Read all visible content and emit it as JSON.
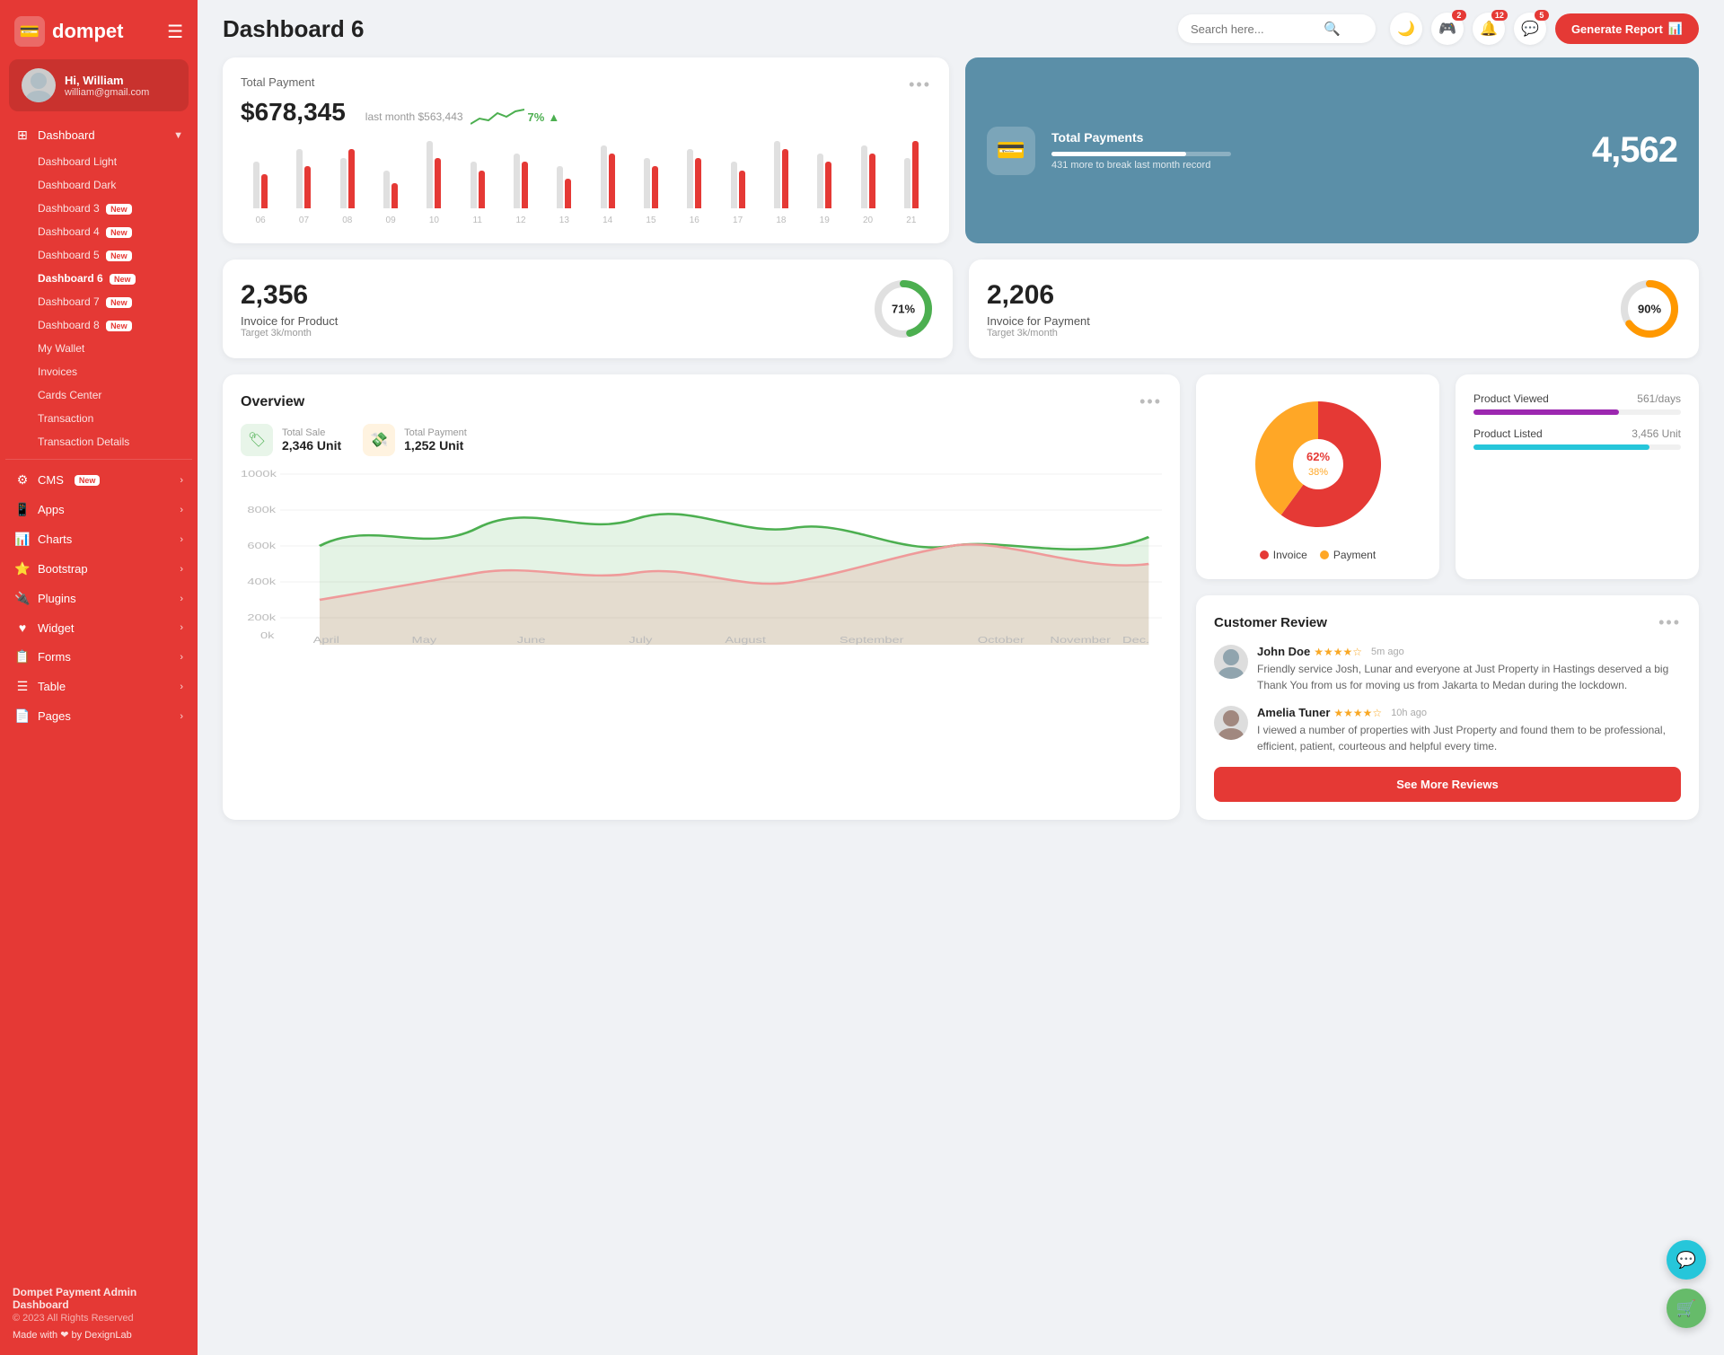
{
  "sidebar": {
    "logo_text": "dompet",
    "hamburger_label": "☰",
    "user": {
      "greeting": "Hi, William",
      "email": "william@gmail.com"
    },
    "dashboard_section": {
      "label": "Dashboard",
      "sub_items": [
        {
          "label": "Dashboard Light",
          "active": false
        },
        {
          "label": "Dashboard Dark",
          "active": false
        },
        {
          "label": "Dashboard 3",
          "active": false,
          "badge": "New"
        },
        {
          "label": "Dashboard 4",
          "active": false,
          "badge": "New"
        },
        {
          "label": "Dashboard 5",
          "active": false,
          "badge": "New"
        },
        {
          "label": "Dashboard 6",
          "active": true,
          "badge": "New"
        },
        {
          "label": "Dashboard 7",
          "active": false,
          "badge": "New"
        },
        {
          "label": "Dashboard 8",
          "active": false,
          "badge": "New"
        },
        {
          "label": "My Wallet",
          "active": false
        },
        {
          "label": "Invoices",
          "active": false
        },
        {
          "label": "Cards Center",
          "active": false
        },
        {
          "label": "Transaction",
          "active": false
        },
        {
          "label": "Transaction Details",
          "active": false
        }
      ]
    },
    "menu_items": [
      {
        "icon": "⚙",
        "label": "CMS",
        "badge": "New",
        "has_arrow": true
      },
      {
        "icon": "📱",
        "label": "Apps",
        "has_arrow": true
      },
      {
        "icon": "📊",
        "label": "Charts",
        "has_arrow": true
      },
      {
        "icon": "⭐",
        "label": "Bootstrap",
        "has_arrow": true
      },
      {
        "icon": "🔌",
        "label": "Plugins",
        "has_arrow": true
      },
      {
        "icon": "♥",
        "label": "Widget",
        "has_arrow": true
      },
      {
        "icon": "📋",
        "label": "Forms",
        "has_arrow": true
      },
      {
        "icon": "☰",
        "label": "Table",
        "has_arrow": true
      },
      {
        "icon": "📄",
        "label": "Pages",
        "has_arrow": true
      }
    ],
    "footer": {
      "brand": "Dompet Payment Admin Dashboard",
      "copyright": "© 2023 All Rights Reserved",
      "made_with": "Made with ❤ by DexignLab"
    }
  },
  "header": {
    "title": "Dashboard 6",
    "search_placeholder": "Search here...",
    "notifications": [
      {
        "icon": "🎮",
        "count": 2
      },
      {
        "icon": "🔔",
        "count": 12
      },
      {
        "icon": "💬",
        "count": 5
      }
    ],
    "generate_button": "Generate Report"
  },
  "total_payment_card": {
    "label": "Total Payment",
    "amount": "$678,345",
    "last_month_text": "last month $563,443",
    "trend_percent": "7%",
    "trend_up": true,
    "bars": [
      {
        "gray": 55,
        "red": 40
      },
      {
        "gray": 70,
        "red": 50
      },
      {
        "gray": 60,
        "red": 70
      },
      {
        "gray": 45,
        "red": 30
      },
      {
        "gray": 80,
        "red": 60
      },
      {
        "gray": 55,
        "red": 45
      },
      {
        "gray": 65,
        "red": 55
      },
      {
        "gray": 50,
        "red": 35
      },
      {
        "gray": 75,
        "red": 65
      },
      {
        "gray": 60,
        "red": 50
      },
      {
        "gray": 70,
        "red": 60
      },
      {
        "gray": 55,
        "red": 45
      },
      {
        "gray": 80,
        "red": 70
      },
      {
        "gray": 65,
        "red": 55
      },
      {
        "gray": 75,
        "red": 65
      },
      {
        "gray": 60,
        "red": 80
      }
    ],
    "bar_labels": [
      "06",
      "07",
      "08",
      "09",
      "10",
      "11",
      "12",
      "13",
      "14",
      "15",
      "16",
      "17",
      "18",
      "19",
      "20",
      "21"
    ]
  },
  "total_payments_blue": {
    "icon": "💳",
    "label": "Total Payments",
    "sub": "431 more to break last month record",
    "value": "4,562",
    "bar_percent": 75
  },
  "invoice_product": {
    "value": "2,356",
    "label": "Invoice for Product",
    "target": "Target 3k/month",
    "percent": 71,
    "color": "#4caf50"
  },
  "invoice_payment": {
    "value": "2,206",
    "label": "Invoice for Payment",
    "target": "Target 3k/month",
    "percent": 90,
    "color": "#ff9800"
  },
  "overview": {
    "title": "Overview",
    "total_sale_label": "Total Sale",
    "total_sale_value": "2,346 Unit",
    "total_payment_label": "Total Payment",
    "total_payment_value": "1,252 Unit",
    "x_labels": [
      "April",
      "May",
      "June",
      "July",
      "August",
      "September",
      "October",
      "November",
      "Dec."
    ],
    "y_labels": [
      "1000k",
      "800k",
      "600k",
      "400k",
      "200k",
      "0k"
    ]
  },
  "pie_chart": {
    "invoice_percent": 62,
    "payment_percent": 38,
    "invoice_label": "Invoice",
    "payment_label": "Payment",
    "invoice_color": "#e53935",
    "payment_color": "#ffa726"
  },
  "product_stats": {
    "viewed_label": "Product Viewed",
    "viewed_value": "561/days",
    "viewed_color": "#9c27b0",
    "viewed_percent": 70,
    "listed_label": "Product Listed",
    "listed_value": "3,456 Unit",
    "listed_color": "#26c6da",
    "listed_percent": 85
  },
  "customer_review": {
    "title": "Customer Review",
    "reviews": [
      {
        "name": "John Doe",
        "stars": 4,
        "time": "5m ago",
        "text": "Friendly service Josh, Lunar and everyone at Just Property in Hastings deserved a big Thank You from us for moving us from Jakarta to Medan during the lockdown."
      },
      {
        "name": "Amelia Tuner",
        "stars": 4,
        "time": "10h ago",
        "text": "I viewed a number of properties with Just Property and found them to be professional, efficient, patient, courteous and helpful every time."
      }
    ],
    "see_more_button": "See More Reviews"
  },
  "fab": {
    "chat_icon": "💬",
    "cart_icon": "🛒"
  }
}
